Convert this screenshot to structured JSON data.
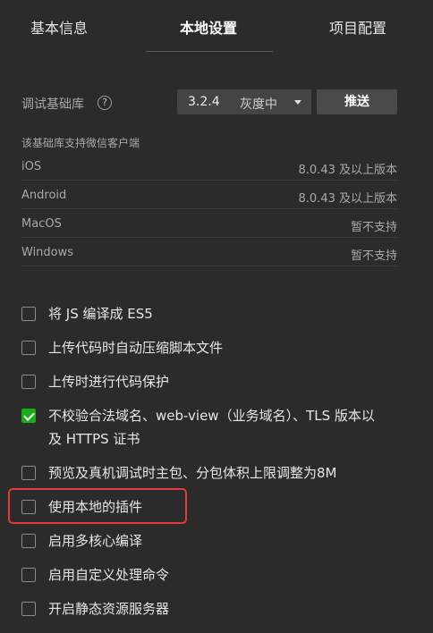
{
  "tabs": [
    {
      "label": "基本信息"
    },
    {
      "label": "本地设置"
    },
    {
      "label": "项目配置"
    }
  ],
  "debug_lib": {
    "label": "调试基础库",
    "help_icon": "?",
    "version": "3.2.4",
    "status": "灰度中",
    "push_label": "推送"
  },
  "support": {
    "note": "该基础库支持微信客户端",
    "platforms": [
      {
        "name": "iOS",
        "version": "8.0.43 及以上版本"
      },
      {
        "name": "Android",
        "version": "8.0.43 及以上版本"
      },
      {
        "name": "MacOS",
        "version": "暂不支持"
      },
      {
        "name": "Windows",
        "version": "暂不支持"
      }
    ]
  },
  "options": [
    {
      "label": "将 JS 编译成 ES5",
      "checked": false
    },
    {
      "label": "上传代码时自动压缩脚本文件",
      "checked": false
    },
    {
      "label": "上传时进行代码保护",
      "checked": false
    },
    {
      "label": "不校验合法域名、web-view（业务域名）、TLS 版本以及 HTTPS 证书",
      "checked": true
    },
    {
      "label": "预览及真机调试时主包、分包体积上限调整为8M",
      "checked": false
    },
    {
      "label": "使用本地的插件",
      "checked": false
    },
    {
      "label": "启用多核心编译",
      "checked": false
    },
    {
      "label": "启用自定义处理命令",
      "checked": false
    },
    {
      "label": "开启静态资源服务器",
      "checked": false
    }
  ],
  "colors": {
    "background": "#2b2b2b",
    "check_accent": "#1aad19",
    "highlight": "#e0393e"
  }
}
